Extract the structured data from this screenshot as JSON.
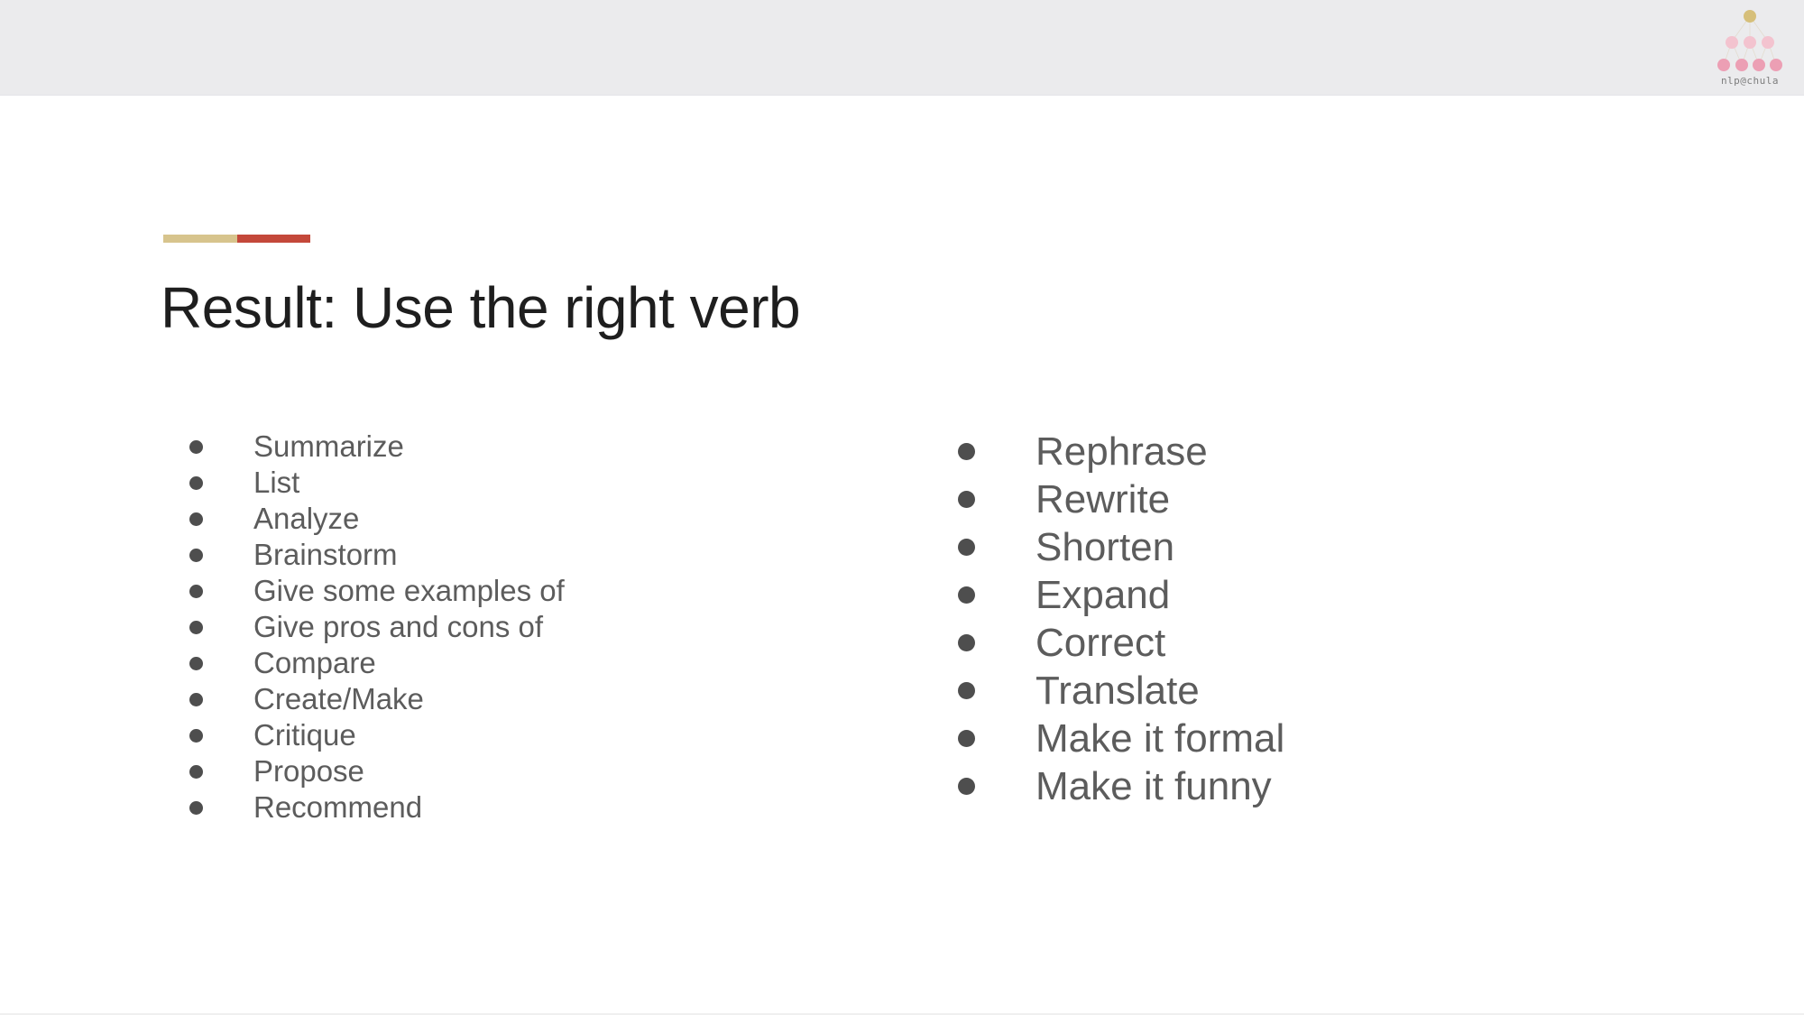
{
  "header": {
    "logo_text": "nlp@chula",
    "logo_colors": {
      "top_node": "#d6bf7a",
      "nodes": "#ec9fb4",
      "nodes_light": "#f3c3cf"
    }
  },
  "slide": {
    "accent_colors": [
      "#d7c48d",
      "#c4483a"
    ],
    "title": "Result: Use the right verb",
    "left_list": [
      "Summarize",
      "List",
      "Analyze",
      "Brainstorm",
      "Give some examples of",
      "Give pros and cons of",
      "Compare",
      "Create/Make",
      "Critique",
      "Propose",
      "Recommend"
    ],
    "right_list": [
      "Rephrase",
      "Rewrite",
      "Shorten",
      "Expand",
      "Correct",
      "Translate",
      "Make it formal",
      "Make it funny"
    ]
  }
}
